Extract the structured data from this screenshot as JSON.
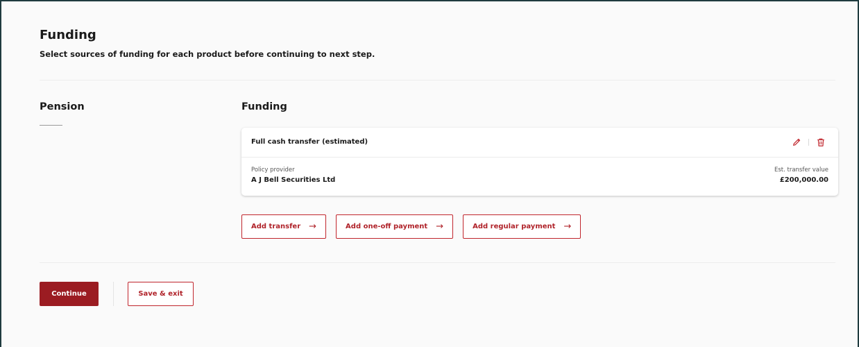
{
  "header": {
    "title": "Funding",
    "subtitle": "Select sources of funding for each product before continuing to next step."
  },
  "product": {
    "label": "Pension"
  },
  "funding": {
    "title": "Funding",
    "card": {
      "title": "Full cash transfer (estimated)",
      "provider_label": "Policy provider",
      "provider_value": "A J Bell Securities Ltd",
      "value_label": "Est. transfer value",
      "value_amount": "£200,000.00",
      "edit_icon": "pencil-icon",
      "delete_icon": "trash-icon"
    },
    "add_buttons": [
      {
        "label": "Add transfer",
        "icon": "arrow-right-icon"
      },
      {
        "label": "Add one-off payment",
        "icon": "arrow-right-icon"
      },
      {
        "label": "Add regular payment",
        "icon": "arrow-right-icon"
      }
    ]
  },
  "footer": {
    "continue_label": "Continue",
    "save_label": "Save & exit"
  },
  "colors": {
    "accent": "#9b1c22",
    "accent_outline": "#c0252c",
    "frame_border": "#1f3b3f"
  }
}
